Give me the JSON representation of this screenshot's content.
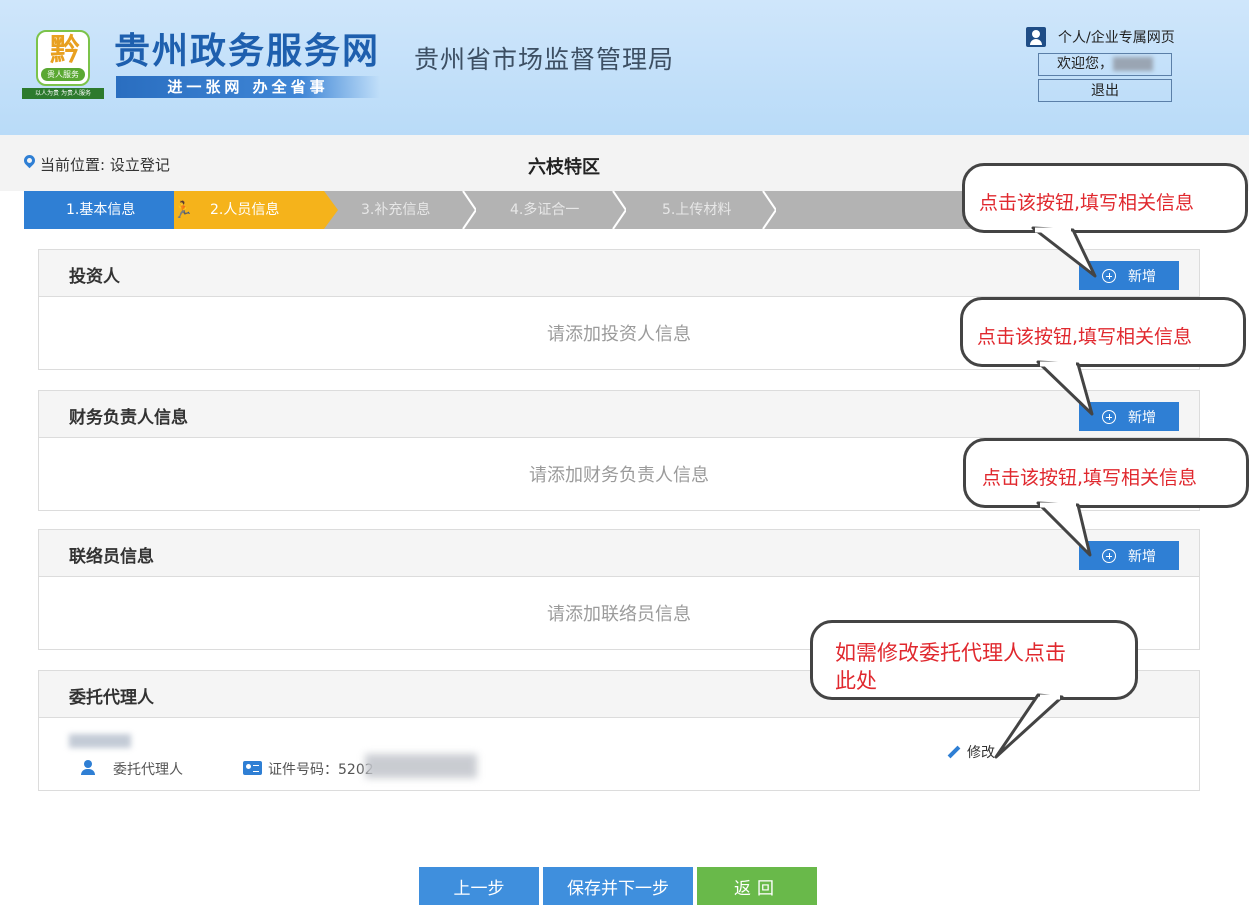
{
  "header": {
    "logo_glyph": "黔",
    "logo_pill": "贵人服务",
    "logo_strip": "以人为贵 为贵人服务",
    "site_name": "贵州政务服务网",
    "slogan": "进一张网  办全省事",
    "org_name": "贵州省市场监督管理局",
    "user_link": "个人/企业专属网页",
    "welcome": "欢迎您，",
    "logout": "退出"
  },
  "location": {
    "label": "当前位置: 设立登记",
    "form_title": "六枝特区"
  },
  "steps": [
    {
      "label": "1.基本信息",
      "state": "done"
    },
    {
      "label": "2.人员信息",
      "state": "active"
    },
    {
      "label": "3.补充信息",
      "state": "todo"
    },
    {
      "label": "4.多证合一",
      "state": "todo"
    },
    {
      "label": "5.上传材料",
      "state": "todo"
    }
  ],
  "sections": {
    "investor": {
      "title": "投资人",
      "empty": "请添加投资人信息",
      "add": "新增"
    },
    "finance": {
      "title": "财务负责人信息",
      "empty": "请添加财务负责人信息",
      "add": "新增"
    },
    "liaison": {
      "title": "联络员信息",
      "empty": "请添加联络员信息",
      "add": "新增"
    },
    "agent": {
      "title": "委托代理人",
      "role": "委托代理人",
      "id_label": "证件号码：5202",
      "edit": "修改"
    }
  },
  "buttons": {
    "prev": "上一步",
    "save": "保存并下一步",
    "back": "返回"
  },
  "callouts": {
    "add1": "点击该按钮,填写相关信息",
    "add2": "点击该按钮,填写相关信息",
    "add3": "点击该按钮,填写相关信息",
    "edit_line1": "如需修改委托代理人点击",
    "edit_line2": "此处"
  },
  "colors": {
    "primary": "#2f7fd4",
    "active_step": "#f5b31b",
    "back_button": "#69b94a",
    "callout_text": "#e0282e"
  }
}
